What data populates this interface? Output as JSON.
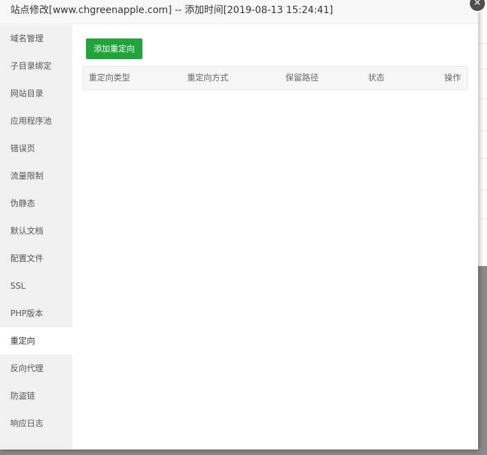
{
  "dialog": {
    "title": "站点修改[www.chgreenapple.com] -- 添加时间[2019-08-13 15:24:41]",
    "close_glyph": "✕"
  },
  "sidebar": {
    "items": [
      {
        "label": "域名管理"
      },
      {
        "label": "子目录绑定"
      },
      {
        "label": "网站目录"
      },
      {
        "label": "应用程序池"
      },
      {
        "label": "错误页"
      },
      {
        "label": "流量限制"
      },
      {
        "label": "伪静态"
      },
      {
        "label": "默认文档"
      },
      {
        "label": "配置文件"
      },
      {
        "label": "SSL"
      },
      {
        "label": "PHP版本"
      },
      {
        "label": "重定向"
      },
      {
        "label": "反向代理"
      },
      {
        "label": "防盗链"
      },
      {
        "label": "响应日志"
      }
    ],
    "active_index": 11
  },
  "main": {
    "add_button": "添加重定向",
    "table": {
      "headers": [
        "重定向类型",
        "重定向方式",
        "保留路径",
        "状态",
        "操作"
      ]
    }
  },
  "colors": {
    "accent": "#20a53a",
    "sidebar_bg": "#f0f0f0",
    "title_bg": "#f8f8f8"
  }
}
